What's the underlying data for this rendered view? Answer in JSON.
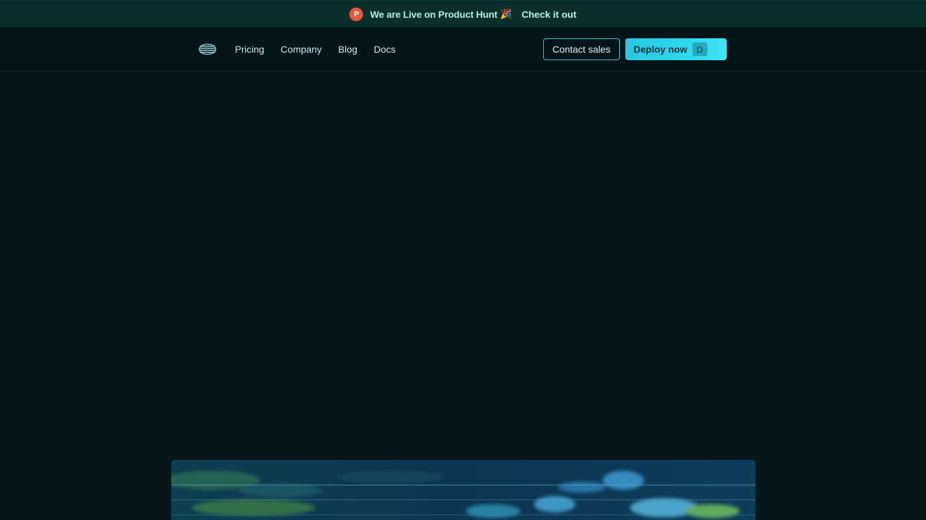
{
  "announcement": {
    "badge": "P",
    "message": "We are Live on Product Hunt",
    "emoji": "🎉",
    "link": "Check it out"
  },
  "nav": {
    "logo_icon": "striped-globe-icon",
    "links": [
      "Pricing",
      "Company",
      "Blog",
      "Docs"
    ],
    "contact_label": "Contact sales",
    "deploy_label": "Deploy now",
    "deploy_shortcut": "D"
  },
  "colors": {
    "background": "#061619",
    "announcement_bg": "#0a2e2c",
    "accent": "#2fd8ef",
    "product_hunt": "#e8563a"
  }
}
